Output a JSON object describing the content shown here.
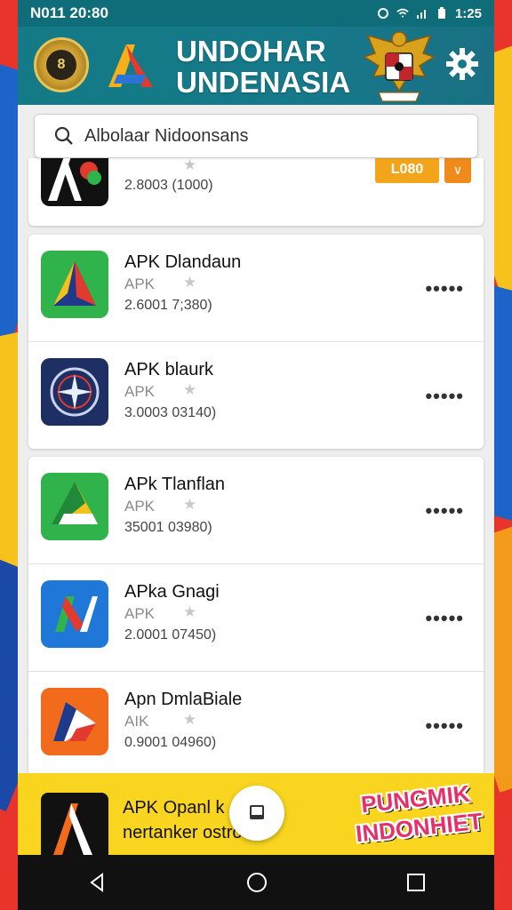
{
  "status": {
    "left": "N011 20:80",
    "right": "1:25"
  },
  "header": {
    "title_line1": "UNDOHAR",
    "title_line2": "UNDENASIA",
    "emblem_glyph": "8"
  },
  "search": {
    "value": "Albolaar Nidoonsans",
    "placeholder": "Albolaar Nidoonsans"
  },
  "partial_item": {
    "meta": "2.8003 (1000)",
    "badge": "L080",
    "chevron": "∨"
  },
  "apps": [
    {
      "name": "APK Dlandaun",
      "type": "APK",
      "meta": "2.6001 7;380)",
      "colors": [
        "#2fb34a",
        "#1a6e3a"
      ]
    },
    {
      "name": "APK blaurk",
      "type": "APK",
      "meta": "3.0003 03140)",
      "colors": [
        "#1d2f63",
        "#f0f0f0"
      ]
    },
    {
      "name": "APk Tlanflan",
      "type": "APK",
      "meta": "35001 03980)",
      "colors": [
        "#2fb34a",
        "#f2c51c"
      ]
    },
    {
      "name": "APka Gnagi",
      "type": "APK",
      "meta": "2.0001 07450)",
      "colors": [
        "#1f78d8",
        "#ffffff"
      ]
    },
    {
      "name": "Apn DmlaBiale",
      "type": "AIK",
      "meta": "0.9001 04960)",
      "colors": [
        "#f26a1b",
        "#ffffff"
      ]
    }
  ],
  "more_label": "•••••",
  "star": "★",
  "banner": {
    "line1": "APK Opanl k",
    "line2": "nertanker ostrosi",
    "promo1": "PUNGMIK",
    "promo2": "INDONHIET"
  },
  "accent": "#147a86"
}
